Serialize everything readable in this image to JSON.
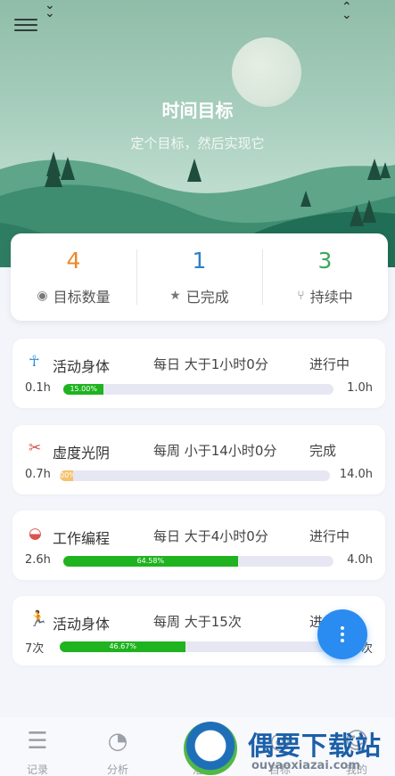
{
  "header": {
    "title": "时间目标",
    "subtitle": "定个目标，然后实现它",
    "menu_icon": "hamburger-menu-icon",
    "sort_icon": "sort-chevrons-icon"
  },
  "stats": [
    {
      "value": "4",
      "label": "目标数量",
      "icon": "eye-icon",
      "color": "#e8892e"
    },
    {
      "value": "1",
      "label": "已完成",
      "icon": "star-icon",
      "color": "#2e7fc8"
    },
    {
      "value": "3",
      "label": "持续中",
      "icon": "branch-icon",
      "color": "#3aa757"
    }
  ],
  "goals": [
    {
      "icon": "figure-icon",
      "icon_color": "#2e8bd8",
      "name": "活动身体",
      "rule": "每日 大于1小时0分",
      "status": "进行中",
      "min": "0.1h",
      "max": "1.0h",
      "progress": 0.15,
      "progress_label": "15.00%",
      "bar_color": "#1fb31f"
    },
    {
      "icon": "scissors-icon",
      "icon_color": "#d9534f",
      "name": "虚度光阴",
      "rule": "每周 小于14小时0分",
      "status": "完成",
      "min": "0.7h",
      "max": "14.0h",
      "progress": 0.05,
      "progress_label": "00%",
      "bar_color": "#f5c16c"
    },
    {
      "icon": "bowl-icon",
      "icon_color": "#d9534f",
      "name": "工作编程",
      "rule": "每日 大于4小时0分",
      "status": "进行中",
      "min": "2.6h",
      "max": "4.0h",
      "progress": 0.6458,
      "progress_label": "64.58%",
      "bar_color": "#1fb31f"
    },
    {
      "icon": "runner-icon",
      "icon_color": "#2bb673",
      "name": "活动身体",
      "rule": "每周 大于15次",
      "status": "进行中",
      "min": "7次",
      "max": "15次",
      "progress": 0.4667,
      "progress_label": "46.67%",
      "bar_color": "#1fb31f"
    }
  ],
  "fab_icon": "more-vertical-icon",
  "tabs": [
    {
      "label": "记录",
      "icon": "record-list-icon"
    },
    {
      "label": "分析",
      "icon": "pie-chart-icon"
    },
    {
      "label": "活动",
      "icon": "activity-icon"
    },
    {
      "label": "目标",
      "icon": "target-icon"
    },
    {
      "label": "我的",
      "icon": "user-icon"
    }
  ],
  "watermark": {
    "title": "偶要下载站",
    "url": "ouyaoxiazai.com"
  }
}
